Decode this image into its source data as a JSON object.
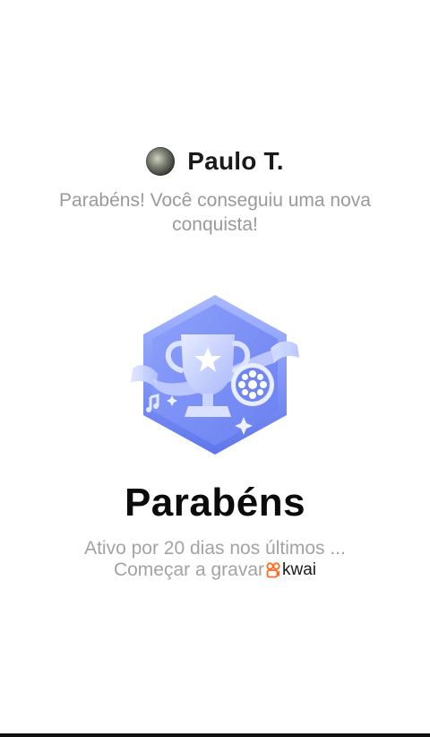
{
  "profile": {
    "name": "Paulo T."
  },
  "message": {
    "subtitle": "Parabéns! Você conseguiu uma nova conquista!"
  },
  "badge": {
    "icon": "trophy-film-reel-badge-icon",
    "color": "#6f86f2"
  },
  "achievement": {
    "title": "Parabéns",
    "description_line1": "Ativo por 20 dias nos últimos ...",
    "description_line2": "Começar a gravar"
  },
  "watermark": {
    "brand": "kwai",
    "color": "#ff6a1f"
  }
}
